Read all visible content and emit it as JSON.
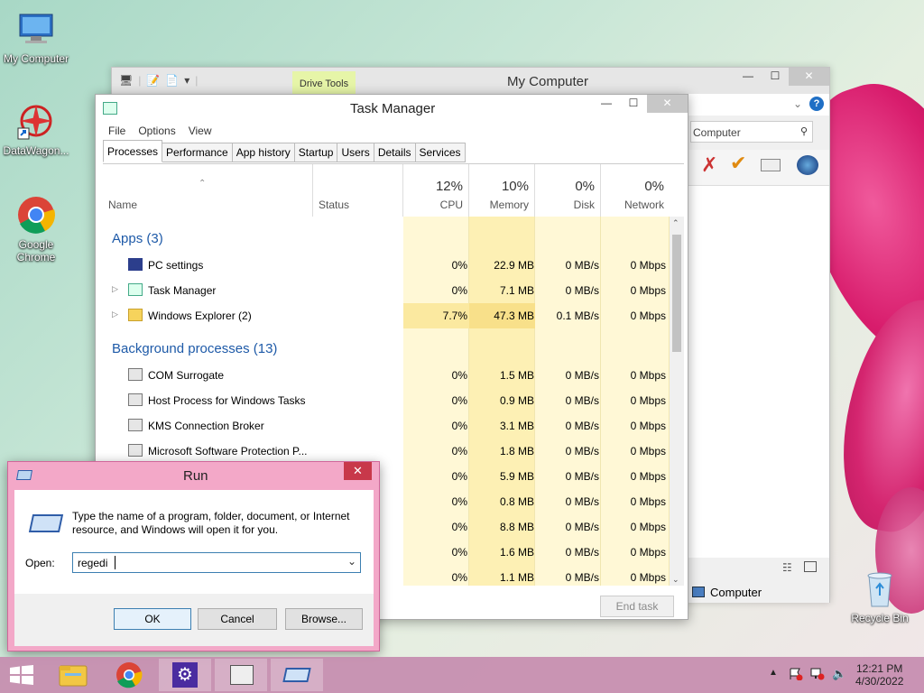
{
  "desktop": {
    "icons": [
      {
        "label": "My Computer"
      },
      {
        "label": "DataWagon..."
      },
      {
        "label": "Google Chrome"
      },
      {
        "label": "Recycle Bin"
      }
    ]
  },
  "mycomputer": {
    "title": "My Computer",
    "drive_tools": "Drive Tools",
    "search_placeholder": "Computer",
    "status": "Computer"
  },
  "taskmanager": {
    "title": "Task Manager",
    "menu": [
      "File",
      "Options",
      "View"
    ],
    "tabs": [
      "Processes",
      "Performance",
      "App history",
      "Startup",
      "Users",
      "Details",
      "Services"
    ],
    "columns": {
      "name": "Name",
      "status": "Status",
      "cpu": {
        "pct": "12%",
        "label": "CPU"
      },
      "memory": {
        "pct": "10%",
        "label": "Memory"
      },
      "disk": {
        "pct": "0%",
        "label": "Disk"
      },
      "network": {
        "pct": "0%",
        "label": "Network"
      }
    },
    "apps_header": "Apps (3)",
    "apps": [
      {
        "name": "PC settings",
        "cpu": "0%",
        "memory": "22.9 MB",
        "disk": "0 MB/s",
        "network": "0 Mbps"
      },
      {
        "name": "Task Manager",
        "cpu": "0%",
        "memory": "7.1 MB",
        "disk": "0 MB/s",
        "network": "0 Mbps"
      },
      {
        "name": "Windows Explorer (2)",
        "cpu": "7.7%",
        "memory": "47.3 MB",
        "disk": "0.1 MB/s",
        "network": "0 Mbps"
      }
    ],
    "bg_header": "Background processes (13)",
    "bg": [
      {
        "name": "COM Surrogate",
        "cpu": "0%",
        "memory": "1.5 MB",
        "disk": "0 MB/s",
        "network": "0 Mbps"
      },
      {
        "name": "Host Process for Windows Tasks",
        "cpu": "0%",
        "memory": "0.9 MB",
        "disk": "0 MB/s",
        "network": "0 Mbps"
      },
      {
        "name": "KMS Connection Broker",
        "cpu": "0%",
        "memory": "3.1 MB",
        "disk": "0 MB/s",
        "network": "0 Mbps"
      },
      {
        "name": "Microsoft Software Protection P...",
        "cpu": "0%",
        "memory": "1.8 MB",
        "disk": "0 MB/s",
        "network": "0 Mbps"
      },
      {
        "name": "",
        "cpu": "0%",
        "memory": "5.9 MB",
        "disk": "0 MB/s",
        "network": "0 Mbps"
      },
      {
        "name": "",
        "cpu": "0%",
        "memory": "0.8 MB",
        "disk": "0 MB/s",
        "network": "0 Mbps"
      },
      {
        "name": "",
        "cpu": "0%",
        "memory": "8.8 MB",
        "disk": "0 MB/s",
        "network": "0 Mbps"
      },
      {
        "name": "",
        "cpu": "0%",
        "memory": "1.6 MB",
        "disk": "0 MB/s",
        "network": "0 Mbps"
      },
      {
        "name": "",
        "cpu": "0%",
        "memory": "1.1 MB",
        "disk": "0 MB/s",
        "network": "0 Mbps"
      }
    ],
    "end_task": "End task"
  },
  "run": {
    "title": "Run",
    "description": "Type the name of a program, folder, document, or Internet resource, and Windows will open it for you.",
    "open_label": "Open:",
    "input_value": "regedi",
    "ok": "OK",
    "cancel": "Cancel",
    "browse": "Browse..."
  },
  "taskbar": {
    "time": "12:21 PM",
    "date": "4/30/2022"
  }
}
